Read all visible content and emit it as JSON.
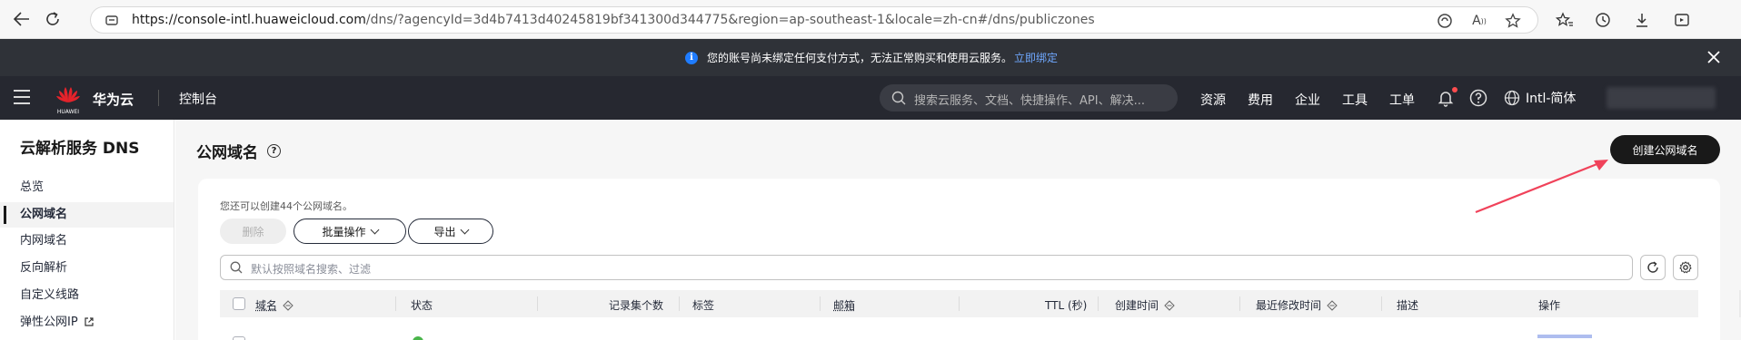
{
  "browser": {
    "url_host": "https://console-intl.huaweicloud.com",
    "url_path": "/dns/?agencyId=3d4b7413d40245819bf341300d344775&region=ap-southeast-1&locale=zh-cn#/dns/publiczones"
  },
  "notice": {
    "text": "您的账号尚未绑定任何支付方式，无法正常购买和使用云服务。",
    "link": "立即绑定"
  },
  "topnav": {
    "brand": "华为云",
    "logo_text": "HUAWEI",
    "console": "控制台",
    "search_placeholder": "搜索云服务、文档、快捷操作、API、解决...",
    "links": [
      "资源",
      "费用",
      "企业",
      "工具",
      "工单"
    ],
    "language": "Intl-简体"
  },
  "sidebar": {
    "title": "云解析服务 DNS",
    "items": [
      {
        "label": "总览"
      },
      {
        "label": "公网域名"
      },
      {
        "label": "内网域名"
      },
      {
        "label": "反向解析"
      },
      {
        "label": "自定义线路"
      },
      {
        "label": "弹性公网IP"
      }
    ]
  },
  "main": {
    "title": "公网域名",
    "create_button": "创建公网域名",
    "quota_text": "您还可以创建44个公网域名。",
    "toolbar": {
      "delete": "删除",
      "batch": "批量操作",
      "export": "导出"
    },
    "filter_placeholder": "默认按照域名搜索、过滤",
    "columns": [
      "域名",
      "状态",
      "记录集个数",
      "标签",
      "邮箱",
      "TTL (秒)",
      "创建时间",
      "最近修改时间",
      "描述",
      "操作"
    ]
  },
  "colors": {
    "accent": "#191919",
    "link": "#5e7ce0",
    "annotation_arrow": "#f0425a"
  }
}
